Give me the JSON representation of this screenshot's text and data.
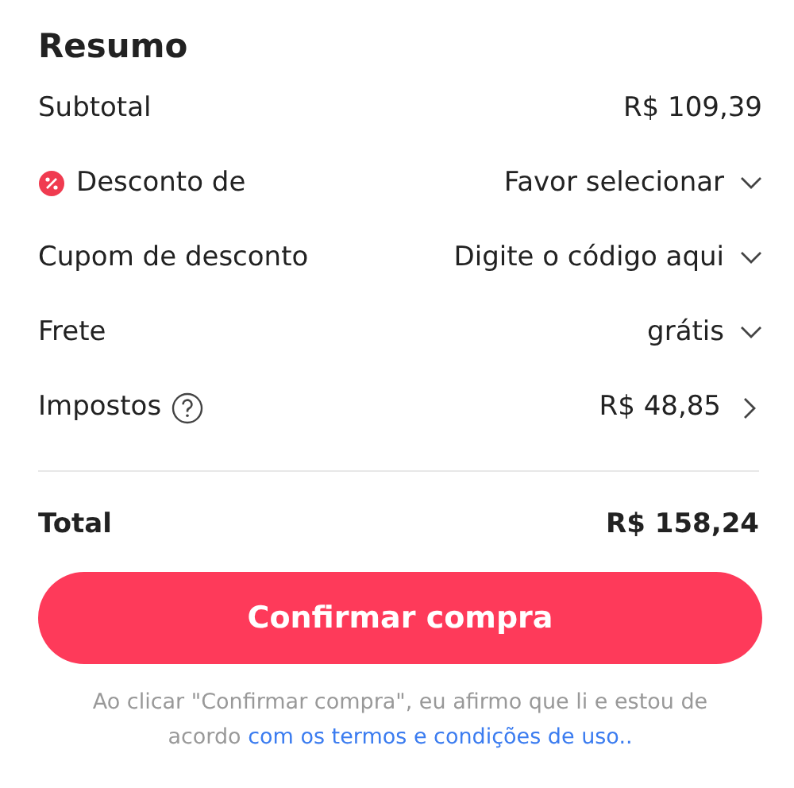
{
  "title": "Resumo",
  "rows": [
    {
      "kind": "amount",
      "label": "Subtotal",
      "value": "R$ 109,39"
    },
    {
      "kind": "promo",
      "label": "Desconto de",
      "value": "Favor selecionar"
    },
    {
      "kind": "dropdown",
      "label": "Cupom de desconto",
      "value": "Digite o código aqui"
    },
    {
      "kind": "dropdown",
      "label": "Frete",
      "value": "grátis"
    },
    {
      "kind": "tax",
      "label": "Impostos",
      "value": "R$ 48,85"
    }
  ],
  "total": {
    "label": "Total",
    "value": "R$ 158,24"
  },
  "button": "Confirmar compra",
  "disclaimer": {
    "text": "Ao clicar \"Confirmar compra\", eu afirmo que li e estou de acordo",
    "link": "com os termos e condições de uso.."
  }
}
